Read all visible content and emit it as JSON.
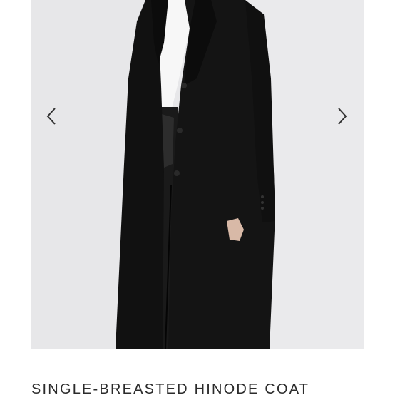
{
  "product": {
    "title": "SINGLE-BREASTED HINODE COAT"
  },
  "gallery": {
    "image_subject": "model wearing black long single-breasted coat over white turtleneck",
    "prev_icon": "chevron-left-icon",
    "next_icon": "chevron-right-icon"
  },
  "colors": {
    "background": "#ffffff",
    "photo_backdrop": "#e6e6e8",
    "coat": "#111111",
    "arrow": "#333333",
    "title_text": "#2b2b2b"
  }
}
